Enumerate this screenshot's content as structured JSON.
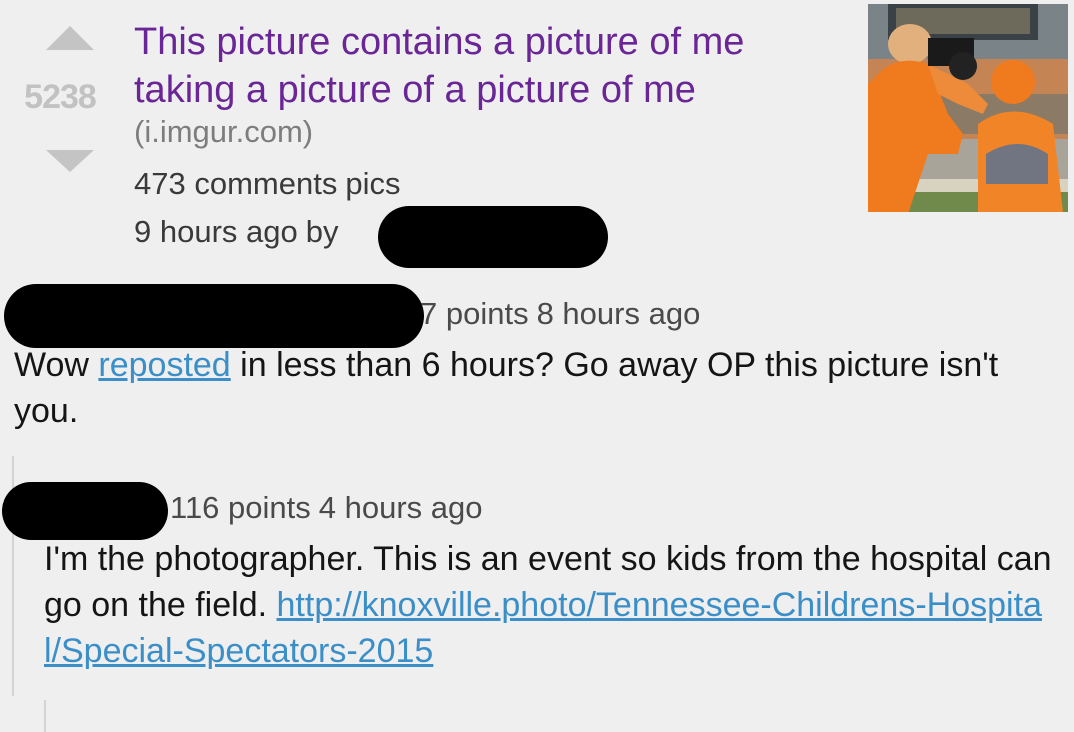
{
  "post": {
    "score": "5238",
    "title": "This picture contains a picture of me taking a picture of a picture of me",
    "domain": "(i.imgur.com)",
    "comments": "473 comments",
    "subreddit": "pics",
    "age": "9 hours ago",
    "by": "by"
  },
  "comments": [
    {
      "points": "7 points",
      "age": "8 hours ago",
      "text_before": "Wow ",
      "link_text": "reposted",
      "text_after": " in less than 6 hours? Go away OP this picture isn't you."
    },
    {
      "points": "116 points",
      "age": "4 hours ago",
      "text_before": "I'm the photographer. This is an event so kids from the hospital can go on the field. ",
      "link_text": "http://knoxville.photo/Tennessee-Childrens-Hospital/Special-Spectators-2015"
    }
  ],
  "colors": {
    "title": "#6a2596",
    "link": "#3a8fc8",
    "score": "#c2c2c2",
    "background": "#efefef"
  },
  "icons": {
    "upvote": "upvote-arrow-icon",
    "downvote": "downvote-arrow-icon"
  }
}
